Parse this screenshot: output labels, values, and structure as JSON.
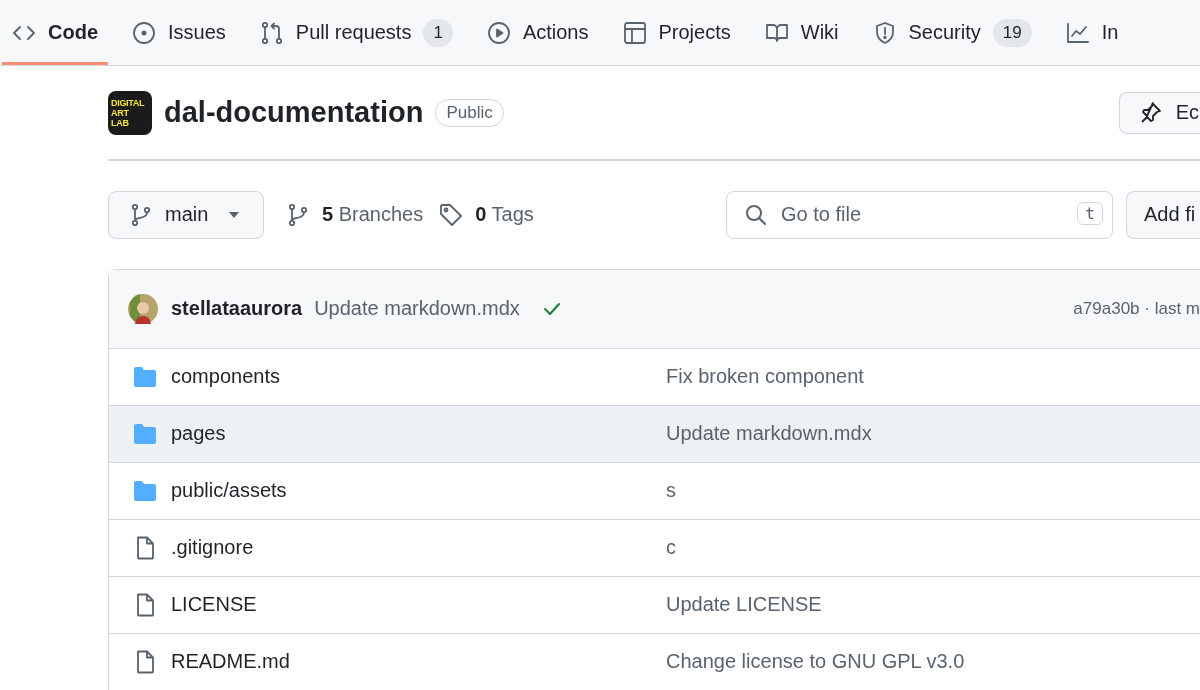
{
  "tabs": [
    {
      "label": "Code",
      "selected": true
    },
    {
      "label": "Issues",
      "selected": false
    },
    {
      "label": "Pull requests",
      "count": "1",
      "selected": false
    },
    {
      "label": "Actions",
      "selected": false
    },
    {
      "label": "Projects",
      "selected": false
    },
    {
      "label": "Wiki",
      "selected": false
    },
    {
      "label": "Security",
      "count": "19",
      "selected": false
    },
    {
      "label": "In",
      "selected": false
    }
  ],
  "repo": {
    "logo_lines": [
      "DIGITAL",
      "ART",
      "LAB"
    ],
    "name": "dal-documentation",
    "visibility": "Public",
    "pin_button": "Ec"
  },
  "toolbar": {
    "branch": "main",
    "branches_count": "5",
    "branches_label": "Branches",
    "tags_count": "0",
    "tags_label": "Tags",
    "search_placeholder": "Go to file",
    "shortcut": "t",
    "add_button": "Add fi"
  },
  "commit": {
    "author": "stellataaurora",
    "message": "Update markdown.mdx",
    "checks_passed": true,
    "info": "a79a30b · last m"
  },
  "files": [
    {
      "kind": "folder",
      "name": "components",
      "message": "Fix broken component",
      "highlighted": false
    },
    {
      "kind": "folder",
      "name": "pages",
      "message": "Update markdown.mdx",
      "highlighted": true
    },
    {
      "kind": "folder",
      "name": "public/assets",
      "message": "s",
      "highlighted": false
    },
    {
      "kind": "file",
      "name": ".gitignore",
      "message": "c",
      "highlighted": false
    },
    {
      "kind": "file",
      "name": "LICENSE",
      "message": "Update LICENSE",
      "highlighted": false
    },
    {
      "kind": "file",
      "name": "README.md",
      "message": "Change license to GNU GPL v3.0",
      "highlighted": false
    }
  ]
}
